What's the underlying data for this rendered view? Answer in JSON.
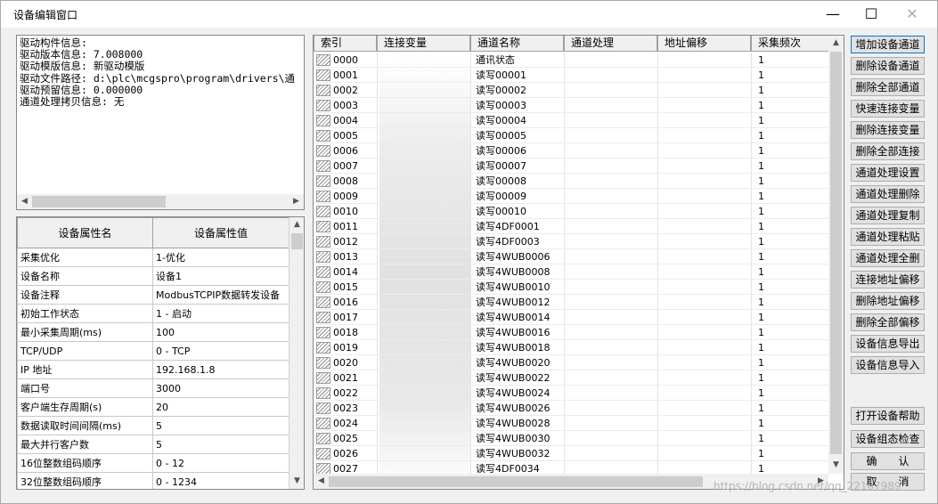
{
  "window": {
    "title": "设备编辑窗口",
    "minimize_glyph": "—",
    "maximize_glyph": "☐",
    "close_glyph": "✕"
  },
  "driver_info": {
    "lines": [
      "驱动构件信息:",
      "驱动版本信息: 7.008000",
      "驱动模版信息: 新驱动模版",
      "驱动文件路径: d:\\plc\\mcgspro\\program\\drivers\\通",
      "驱动预留信息: 0.000000",
      "通道处理拷贝信息: 无"
    ]
  },
  "props": {
    "headers": [
      "设备属性名",
      "设备属性值"
    ],
    "rows": [
      [
        "采集优化",
        "1-优化"
      ],
      [
        "设备名称",
        "设备1"
      ],
      [
        "设备注释",
        "ModbusTCPIP数据转发设备"
      ],
      [
        "初始工作状态",
        "1 - 启动"
      ],
      [
        "最小采集周期(ms)",
        "100"
      ],
      [
        "TCP/UDP",
        "0 - TCP"
      ],
      [
        "IP 地址",
        "192.168.1.8"
      ],
      [
        "端口号",
        "3000"
      ],
      [
        "客户端生存周期(s)",
        "20"
      ],
      [
        "数据读取时间间隔(ms)",
        "5"
      ],
      [
        "最大并行客户数",
        "5"
      ],
      [
        "16位整数组码顺序",
        "0 - 12"
      ],
      [
        "32位整数组码顺序",
        "0 - 1234"
      ]
    ]
  },
  "channels": {
    "headers": [
      "索引",
      "连接变量",
      "通道名称",
      "通道处理",
      "地址偏移",
      "采集频次"
    ],
    "rows": [
      [
        "0000",
        "通讯状态",
        "1"
      ],
      [
        "0001",
        "读写00001",
        "1"
      ],
      [
        "0002",
        "读写00002",
        "1"
      ],
      [
        "0003",
        "读写00003",
        "1"
      ],
      [
        "0004",
        "读写00004",
        "1"
      ],
      [
        "0005",
        "读写00005",
        "1"
      ],
      [
        "0006",
        "读写00006",
        "1"
      ],
      [
        "0007",
        "读写00007",
        "1"
      ],
      [
        "0008",
        "读写00008",
        "1"
      ],
      [
        "0009",
        "读写00009",
        "1"
      ],
      [
        "0010",
        "读写00010",
        "1"
      ],
      [
        "0011",
        "读写4DF0001",
        "1"
      ],
      [
        "0012",
        "读写4DF0003",
        "1"
      ],
      [
        "0013",
        "读写4WUB0006",
        "1"
      ],
      [
        "0014",
        "读写4WUB0008",
        "1"
      ],
      [
        "0015",
        "读写4WUB0010",
        "1"
      ],
      [
        "0016",
        "读写4WUB0012",
        "1"
      ],
      [
        "0017",
        "读写4WUB0014",
        "1"
      ],
      [
        "0018",
        "读写4WUB0016",
        "1"
      ],
      [
        "0019",
        "读写4WUB0018",
        "1"
      ],
      [
        "0020",
        "读写4WUB0020",
        "1"
      ],
      [
        "0021",
        "读写4WUB0022",
        "1"
      ],
      [
        "0022",
        "读写4WUB0024",
        "1"
      ],
      [
        "0023",
        "读写4WUB0026",
        "1"
      ],
      [
        "0024",
        "读写4WUB0028",
        "1"
      ],
      [
        "0025",
        "读写4WUB0030",
        "1"
      ],
      [
        "0026",
        "读写4WUB0032",
        "1"
      ],
      [
        "0027",
        "读写4DF0034",
        "1"
      ]
    ]
  },
  "buttons": {
    "add_channel": "增加设备通道",
    "delete_channel": "删除设备通道",
    "delete_all_channels": "删除全部通道",
    "quick_connect": "快速连接变量",
    "delete_connect": "删除连接变量",
    "delete_all_connect": "删除全部连接",
    "ch_proc_set": "通道处理设置",
    "ch_proc_delete": "通道处理删除",
    "ch_proc_copy": "通道处理复制",
    "ch_proc_paste": "通道处理粘贴",
    "ch_proc_delete_all": "通道处理全删",
    "connect_offset": "连接地址偏移",
    "delete_offset": "删除地址偏移",
    "delete_all_offset": "删除全部偏移",
    "export_info": "设备信息导出",
    "import_info": "设备信息导入",
    "open_help": "打开设备帮助",
    "config_check": "设备组态检查",
    "ok": "确　　认",
    "cancel": "取　　消"
  },
  "watermark": "https://blog.csdn.net/qq_22167989"
}
